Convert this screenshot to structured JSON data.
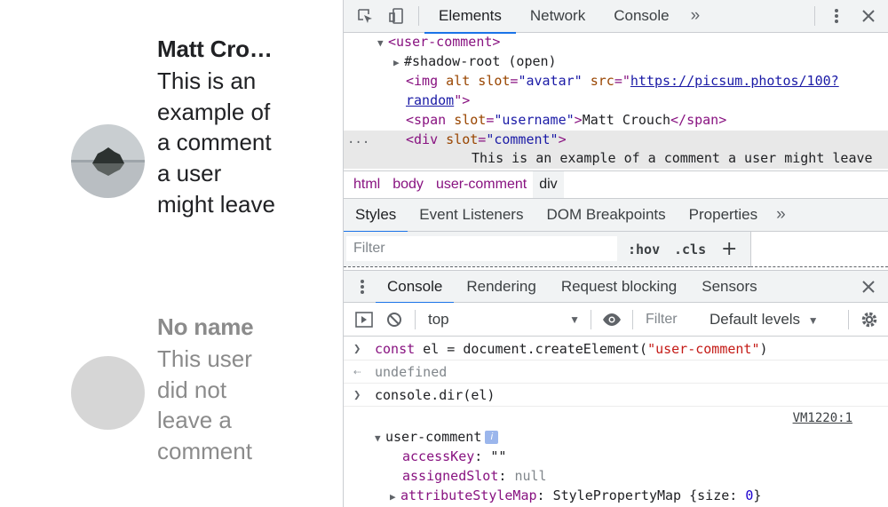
{
  "page": {
    "comments": [
      {
        "name": "Matt Cro…",
        "text": "This is an example of a comment a user might leave"
      },
      {
        "name": "No name",
        "text": "This user did not leave a comment"
      }
    ]
  },
  "devtools": {
    "tabs": [
      "Elements",
      "Network",
      "Console"
    ],
    "active_tab": "Elements",
    "more": "»",
    "dom": {
      "line1": "<user-comment>",
      "line2": "#shadow-root (open)",
      "img_tag": "<img",
      "img_alt": "alt",
      "img_slot_attr": "slot",
      "img_slot_val": "\"avatar\"",
      "img_src_attr": "src",
      "img_src_a": "https://picsum.photos/100?",
      "img_src_b": "random",
      "img_close": "\">",
      "span_open": "<span",
      "span_slot_attr": "slot",
      "span_slot_val": "\"username\"",
      "span_gt": ">",
      "span_text": "Matt Crouch",
      "span_close": "</span>",
      "div_open": "<div",
      "div_slot_attr": "slot",
      "div_slot_val": "\"comment\"",
      "div_gt": ">",
      "div_text": "This is an example of a comment a user might leave",
      "ellipsis": "..."
    },
    "breadcrumbs": [
      "html",
      "body",
      "user-comment",
      "div"
    ],
    "styles_tabs": [
      "Styles",
      "Event Listeners",
      "DOM Breakpoints",
      "Properties"
    ],
    "styles_filter_placeholder": "Filter",
    "hov": ":hov",
    "cls": ".cls",
    "plus": "+",
    "drawer_tabs": [
      "Console",
      "Rendering",
      "Request blocking",
      "Sensors"
    ],
    "console_context": "top",
    "console_filter_placeholder": "Filter",
    "levels": "Default levels",
    "console": {
      "cmd1_kw": "const",
      "cmd1_mid": " el = document.createElement(",
      "cmd1_str": "\"user-comment\"",
      "cmd1_end": ")",
      "result1": "undefined",
      "cmd2": "console.dir(el)",
      "source": "VM1220:1",
      "obj_name": "user-comment",
      "info": "i",
      "props": [
        {
          "key": "accessKey",
          "sep": ": ",
          "val": "\"\""
        },
        {
          "key": "assignedSlot",
          "sep": ": ",
          "val": "null"
        },
        {
          "key": "attributeStyleMap",
          "sep": ": ",
          "val": "StylePropertyMap {size: ",
          "num": "0",
          "end": "}"
        }
      ]
    }
  }
}
